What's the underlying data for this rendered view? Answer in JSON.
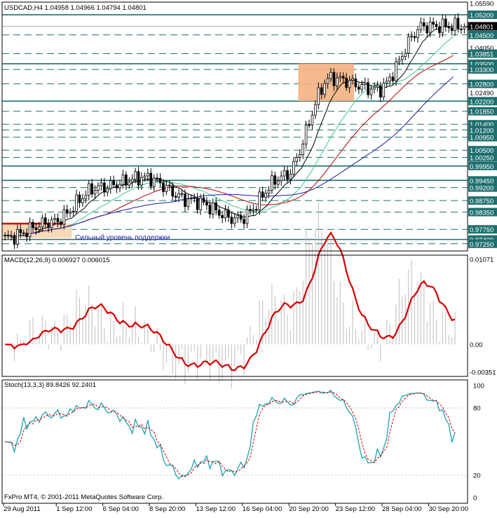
{
  "header": {
    "symbol": "USDCAD,H4",
    "ohlc": "1.04958 1.04966 1.04794 1.04801"
  },
  "main_panel": {
    "price_levels": [
      {
        "value": 1.0559,
        "label": "1.05590",
        "line": "none"
      },
      {
        "value": 1.052,
        "label": "1.05200",
        "line": "solid"
      },
      {
        "value": 1.048,
        "label": "1.04801",
        "line": "current"
      },
      {
        "value": 1.045,
        "label": "1.04500",
        "line": "dash"
      },
      {
        "value": 1.0405,
        "label": "1.04050",
        "line": "none"
      },
      {
        "value": 1.0385,
        "label": "1.03851",
        "line": "dash"
      },
      {
        "value": 1.035,
        "label": "1.03500",
        "line": "solid"
      },
      {
        "value": 1.033,
        "label": "1.03300",
        "line": "dash"
      },
      {
        "value": 1.028,
        "label": "1.02800",
        "line": "dash"
      },
      {
        "value": 1.0249,
        "label": "1.02490",
        "line": "none"
      },
      {
        "value": 1.022,
        "label": "1.02200",
        "line": "solid"
      },
      {
        "value": 1.0185,
        "label": "1.01850",
        "line": "dash"
      },
      {
        "value": 1.014,
        "label": "1.01400",
        "line": "dash"
      },
      {
        "value": 1.012,
        "label": "1.01200",
        "line": "dash"
      },
      {
        "value": 1.0095,
        "label": "1.00950",
        "line": "dash"
      },
      {
        "value": 1.005,
        "label": "1.00500",
        "line": "dash"
      },
      {
        "value": 1.0025,
        "label": "1.00250",
        "line": "dash"
      },
      {
        "value": 0.9995,
        "label": "0.99950",
        "line": "solid"
      },
      {
        "value": 0.9945,
        "label": "0.99450",
        "line": "solid"
      },
      {
        "value": 0.992,
        "label": "0.99200",
        "line": "dash"
      },
      {
        "value": 0.9875,
        "label": "0.98750",
        "line": "dash"
      },
      {
        "value": 0.9835,
        "label": "0.98350",
        "line": "dash"
      },
      {
        "value": 0.9775,
        "label": "0.97750",
        "line": "dash"
      },
      {
        "value": 0.974,
        "label": "0.97400",
        "line": "solid"
      },
      {
        "value": 0.9725,
        "label": "0.97250",
        "line": "dash"
      }
    ],
    "annotation": "Сильный уровень поддержки"
  },
  "macd_panel": {
    "label": "MACD(12,26,9) 0.006927 0.006015",
    "scale": [
      {
        "value": 0.01071,
        "label": "0.01071"
      },
      {
        "value": 0.0,
        "label": "0.00"
      },
      {
        "value": -0.00351,
        "label": "-0.00351"
      }
    ]
  },
  "stoch_panel": {
    "label": "Stoch(13,3,3) 89.8426 92.2401",
    "scale": [
      {
        "value": 100,
        "label": "100"
      },
      {
        "value": 80,
        "label": "80"
      },
      {
        "value": 20,
        "label": "20"
      },
      {
        "value": 0,
        "label": "0"
      }
    ]
  },
  "footer": {
    "copyright": "FxPro MT4, © 2001-2011 MetaQuotes Software Corp."
  },
  "time_axis": [
    "29 Aug 2011",
    "1 Sep 12:00",
    "6 Sep 04:00",
    "8 Sep 20:00",
    "13 Sep 12:00",
    "16 Sep 04:00",
    "20 Sep 20:00",
    "23 Sep 12:00",
    "28 Sep 04:00",
    "30 Sep 20:00"
  ],
  "colors": {
    "background": "#ffffff",
    "grid": "#1f6f6f",
    "candles": "#000000",
    "zone_fill": "#f4b183",
    "support_line": "#d40000",
    "support_fill": "#f6d5b0",
    "ma_fast": "#000000",
    "ma_medium": "#3cc98c",
    "ma_slow": "#b00000",
    "ma_slowest": "#1a1aa0",
    "macd_line": "#d40000",
    "macd_hist": "#bdbdbd",
    "stoch_main": "#1aa3b0",
    "stoch_signal": "#d40000",
    "current_price_bg": "#000000",
    "annotation_text": "#1a1aa0"
  },
  "chart_data": {
    "type": "line",
    "title": "USDCAD,H4",
    "x": [
      "29 Aug 2011",
      "1 Sep 12:00",
      "6 Sep 04:00",
      "8 Sep 20:00",
      "13 Sep 12:00",
      "16 Sep 04:00",
      "20 Sep 20:00",
      "23 Sep 12:00",
      "28 Sep 04:00",
      "30 Sep 20:00"
    ],
    "ylim": [
      0.9705,
      1.0559
    ],
    "series": [
      {
        "values": [
          0.9745,
          0.98,
          0.992,
          0.9955,
          0.9875,
          0.981,
          0.996,
          1.03,
          1.026,
          1.048
        ]
      }
    ],
    "resistance_zone": {
      "from": 1.022,
      "to": 1.035
    },
    "support_zone": {
      "from": 0.9745,
      "to": 0.9795
    },
    "macd": {
      "range": [
        -0.00351,
        0.01071
      ],
      "main": 0.006927,
      "signal": 0.006015
    },
    "stochastic": {
      "range": [
        0,
        100
      ],
      "main": 89.8426,
      "signal": 92.2401
    }
  }
}
